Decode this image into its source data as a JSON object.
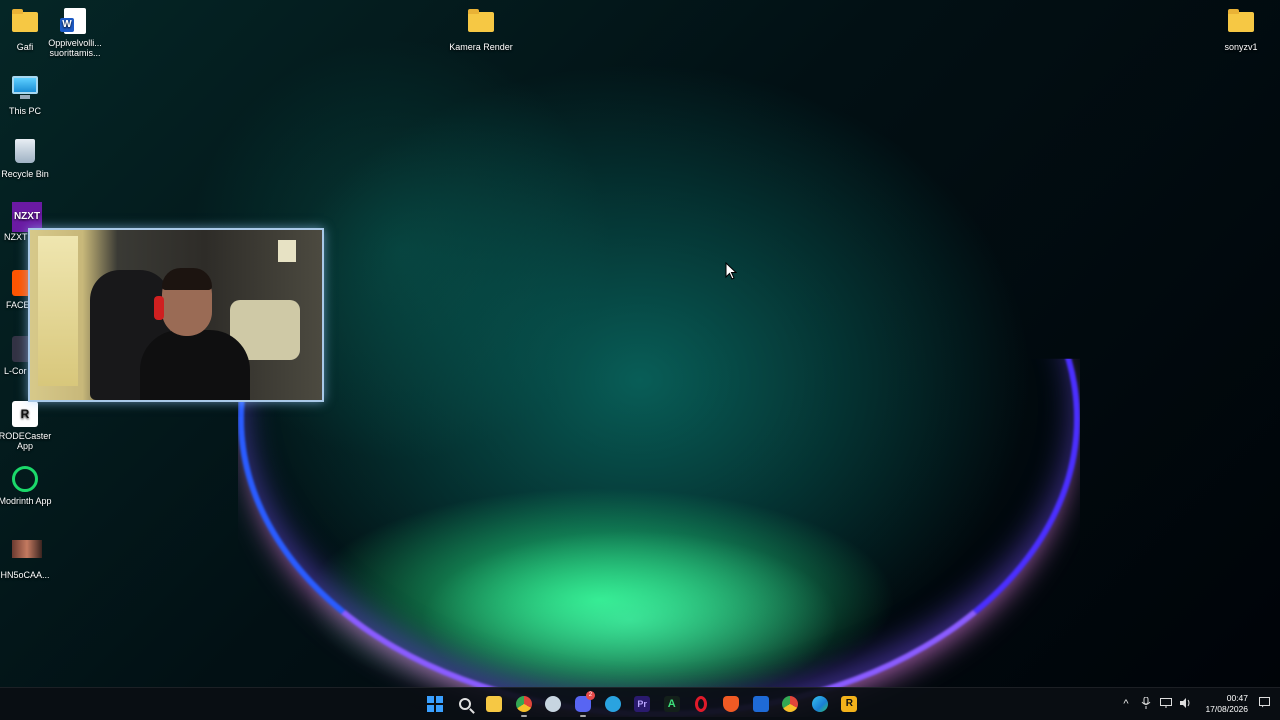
{
  "desktop": {
    "icons": [
      {
        "label": "Gafi",
        "icon": "folder-icon"
      },
      {
        "label": "Oppivelvolli... suorittamis...",
        "icon": "word-document-icon"
      },
      {
        "label": "This PC",
        "icon": "this-pc-icon"
      },
      {
        "label": "Recycle Bin",
        "icon": "recycle-bin-icon"
      },
      {
        "label": "NZXT",
        "icon": "nzxt-icon",
        "glyph_text": "NZXT"
      },
      {
        "label": "FACE",
        "icon": "faceit-icon"
      },
      {
        "label": "L-Cor",
        "icon": "l-connect-icon"
      },
      {
        "label": "RODECaster App",
        "icon": "rodecaster-icon",
        "glyph_text": "R"
      },
      {
        "label": "Modrinth App",
        "icon": "modrinth-icon"
      },
      {
        "label": "HN5oCAA...",
        "icon": "image-thumbnail-icon"
      },
      {
        "label": "Kamera Render",
        "icon": "folder-icon"
      },
      {
        "label": "sonyzv1",
        "icon": "folder-icon"
      }
    ]
  },
  "webcam": {
    "label": "webcam-overlay"
  },
  "taskbar": {
    "apps": [
      {
        "name": "start-button",
        "icon": "windows-logo-icon",
        "color": "#3aa0ff"
      },
      {
        "name": "search-button",
        "icon": "search-icon",
        "color": "#e0e0e0"
      },
      {
        "name": "file-explorer",
        "icon": "file-explorer-icon",
        "color": "#f6c844"
      },
      {
        "name": "chrome",
        "icon": "chrome-icon",
        "color": "#e0453a"
      },
      {
        "name": "steam",
        "icon": "steam-icon",
        "color": "#1b2838"
      },
      {
        "name": "discord",
        "icon": "discord-icon",
        "color": "#5865f2",
        "badge": "2"
      },
      {
        "name": "telegram",
        "icon": "telegram-icon",
        "color": "#2aa3e0"
      },
      {
        "name": "premiere-pro",
        "icon": "premiere-pro-icon",
        "color": "#2a1a6e",
        "text": "Pr"
      },
      {
        "name": "app-a",
        "icon": "a-letter-icon",
        "color": "#1a2a1a",
        "text": "A"
      },
      {
        "name": "opera",
        "icon": "opera-icon",
        "color": "#e01a2a"
      },
      {
        "name": "brave",
        "icon": "brave-icon",
        "color": "#f05a24"
      },
      {
        "name": "app-blue",
        "icon": "blue-app-icon",
        "color": "#1e6ad6"
      },
      {
        "name": "chrome-2",
        "icon": "chrome-icon",
        "color": "#e0453a"
      },
      {
        "name": "edge",
        "icon": "edge-icon",
        "color": "#1fa0d8"
      },
      {
        "name": "rockstar",
        "icon": "rockstar-icon",
        "color": "#f3b21b",
        "text": "R"
      }
    ],
    "tray": {
      "chevron": "^",
      "clock_time": "00:47",
      "clock_date": "17/08/2026"
    }
  }
}
